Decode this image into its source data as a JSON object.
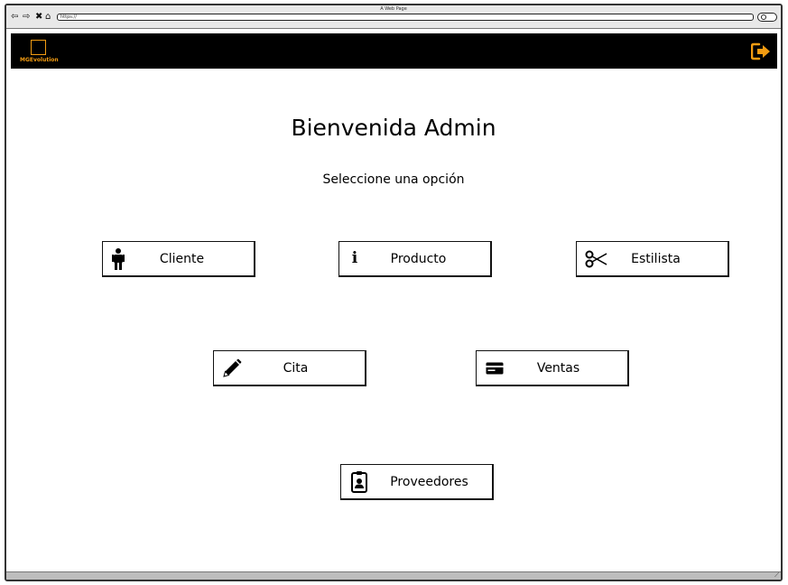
{
  "browser": {
    "window_title": "A Web Page",
    "url": "https://",
    "back_icon": "back-arrow-icon",
    "forward_icon": "forward-arrow-icon",
    "close_icon": "close-icon",
    "home_icon": "home-icon"
  },
  "header": {
    "logo_text": "MGEvolution",
    "logout_icon": "logout-icon",
    "accent_color": "#f39c12",
    "background_color": "#000000"
  },
  "main": {
    "title": "Bienvenida Admin",
    "subtitle": "Seleccione una opción"
  },
  "menu": {
    "cliente": {
      "label": "Cliente",
      "icon": "person-icon"
    },
    "producto": {
      "label": "Producto",
      "icon": "info-icon"
    },
    "estilista": {
      "label": "Estilista",
      "icon": "scissors-icon"
    },
    "cita": {
      "label": "Cita",
      "icon": "pencil-icon"
    },
    "ventas": {
      "label": "Ventas",
      "icon": "credit-card-icon"
    },
    "proveedores": {
      "label": "Proveedores",
      "icon": "id-badge-icon"
    }
  }
}
